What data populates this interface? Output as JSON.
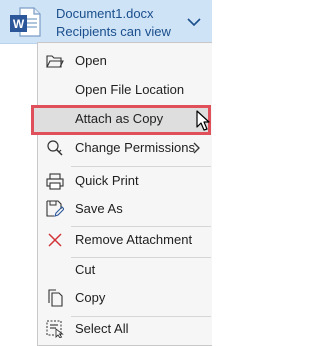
{
  "attachment": {
    "file_name": "Document1.docx",
    "permission": "Recipients can view",
    "icon": "word-doc-icon",
    "icon_letter": "W"
  },
  "menu": {
    "open": "Open",
    "open_location": "Open File Location",
    "attach_copy": "Attach as Copy",
    "change_permissions": "Change Permissions",
    "quick_print": "Quick Print",
    "save_as": "Save As",
    "remove_attachment": "Remove Attachment",
    "cut": "Cut",
    "copy": "Copy",
    "select_all": "Select All"
  },
  "colors": {
    "chip_background": "#cfe3f7",
    "menu_background": "#f6f6f6",
    "highlight_border": "#e0505a",
    "remove_icon": "#d13438"
  }
}
